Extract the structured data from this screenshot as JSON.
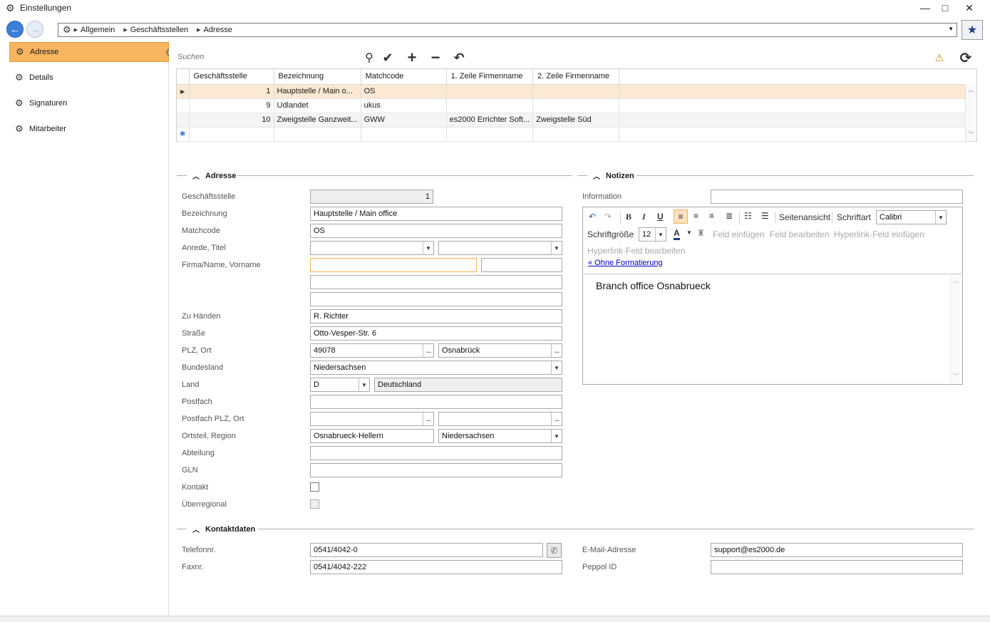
{
  "window": {
    "title": "Einstellungen",
    "minimize": "—",
    "maximize": "□",
    "close": "✕"
  },
  "nav": {
    "breadcrumb": [
      "Allgemein",
      "Geschäftsstellen",
      "Adresse"
    ]
  },
  "sidebar": {
    "items": [
      {
        "label": "Adresse",
        "active": true
      },
      {
        "label": "Details",
        "active": false
      },
      {
        "label": "Signaturen",
        "active": false
      },
      {
        "label": "Mitarbeiter",
        "active": false
      }
    ]
  },
  "toolbar": {
    "search_placeholder": "Suchen"
  },
  "grid": {
    "columns": [
      "Geschäftsstelle",
      "Bezeichnung",
      "Matchcode",
      "1. Zeile Firmenname",
      "2. Zeile Firmenname"
    ],
    "rows": [
      {
        "nr": "1",
        "bezeichnung": "Hauptstelle / Main o...",
        "matchcode": "OS",
        "zeile1": "",
        "zeile2": "",
        "selected": true
      },
      {
        "nr": "9",
        "bezeichnung": "Udlandet",
        "matchcode": "ukus",
        "zeile1": "",
        "zeile2": "",
        "selected": false
      },
      {
        "nr": "10",
        "bezeichnung": "Zweigstelle Ganzweit...",
        "matchcode": "GWW",
        "zeile1": "es2000 Errichter Soft...",
        "zeile2": "Zweigstelle Süd",
        "selected": false
      }
    ]
  },
  "adresse": {
    "header": "Adresse",
    "labels": {
      "geschaeftsstelle": "Geschäftsstelle",
      "bezeichnung": "Bezeichnung",
      "matchcode": "Matchcode",
      "anrede": "Anrede, Titel",
      "firma": "Firma/Name, Vorname",
      "zu_haenden": "Zu Händen",
      "strasse": "Straße",
      "plz_ort": "PLZ, Ort",
      "bundesland": "Bundesland",
      "land": "Land",
      "postfach": "Postfach",
      "postfach_plz": "Postfach PLZ, Ort",
      "ortsteil": "Ortsteil, Region",
      "abteilung": "Abteilung",
      "gln": "GLN",
      "kontakt": "Kontakt",
      "ueberregional": "Überregional"
    },
    "values": {
      "geschaeftsstelle": "1",
      "bezeichnung": "Hauptstelle / Main office",
      "matchcode": "OS",
      "anrede": "",
      "titel": "",
      "firma": "",
      "vorname": "",
      "firma2": "",
      "firma3": "",
      "zu_haenden": "R. Richter",
      "strasse": "Otto-Vesper-Str. 6",
      "plz": "49078",
      "ort": "Osnabrück",
      "bundesland": "Niedersachsen",
      "land_code": "D",
      "land_name": "Deutschland",
      "postfach": "",
      "postfach_plz": "",
      "postfach_ort": "",
      "ortsteil": "Osnabrueck-Hellern",
      "region": "Niedersachsen",
      "abteilung": "",
      "gln": ""
    }
  },
  "notizen": {
    "header": "Notizen",
    "information_label": "Information",
    "information_value": "",
    "editor": {
      "seitenansicht": "Seitenansicht",
      "schriftart_label": "Schriftart",
      "schriftart_value": "Calibri",
      "schriftgroesse_label": "Schriftgröße",
      "schriftgroesse_value": "12",
      "feld_einfuegen": "Feld einfügen",
      "feld_bearbeiten": "Feld bearbeiten",
      "hyperlink_einfuegen": "Hyperlink-Feld einfügen",
      "hyperlink_bearbeiten": "Hyperlink-Feld bearbeiten",
      "ohne_formatierung": "« Ohne Formatierung",
      "content": "Branch office Osnabrueck"
    }
  },
  "kontakt": {
    "header": "Kontaktdaten",
    "telefon_label": "Telefonnr.",
    "telefon_value": "0541/4042-0",
    "fax_label": "Faxnr.",
    "fax_value": "0541/4042-222",
    "email_label": "E-Mail-Adresse",
    "email_value": "support@es2000.de",
    "peppol_label": "Peppol ID",
    "peppol_value": ""
  },
  "colors": {
    "accent": "#f7b560",
    "selected_row": "#fbe9d3",
    "nav_blue": "#3b7fd8"
  }
}
